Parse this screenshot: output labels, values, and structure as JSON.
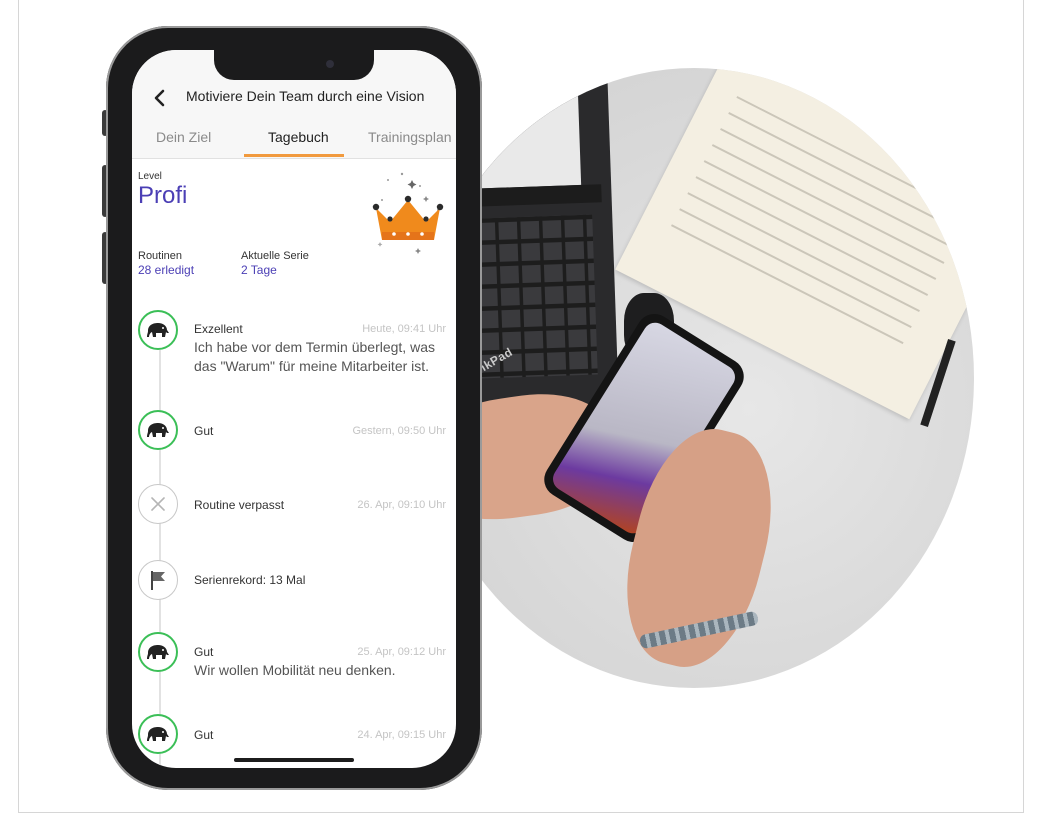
{
  "app": {
    "title": "Motiviere Dein Team durch eine Vision",
    "tabs": [
      {
        "label": "Dein Ziel",
        "active": false
      },
      {
        "label": "Tagebuch",
        "active": true
      },
      {
        "label": "Trainingsplan",
        "active": false
      }
    ]
  },
  "level": {
    "label": "Level",
    "value": "Profi"
  },
  "stats": [
    {
      "label": "Routinen",
      "value": "28 erledigt"
    },
    {
      "label": "Aktuelle Serie",
      "value": "2 Tage"
    }
  ],
  "entries": [
    {
      "icon": "elephant-icon",
      "status": "success",
      "title": "Exzellent",
      "time": "Heute, 09:41 Uhr",
      "text": "Ich habe vor dem Termin überlegt, was das \"Warum\" für meine Mitarbeiter ist."
    },
    {
      "icon": "elephant-icon",
      "status": "success",
      "title": "Gut",
      "time": "Gestern, 09:50 Uhr",
      "text": ""
    },
    {
      "icon": "close-icon",
      "status": "missed",
      "title": "Routine verpasst",
      "time": "26. Apr, 09:10 Uhr",
      "text": ""
    },
    {
      "icon": "flag-icon",
      "status": "record",
      "title": "Serienrekord: 13 Mal",
      "time": "",
      "text": ""
    },
    {
      "icon": "elephant-icon",
      "status": "success",
      "title": "Gut",
      "time": "25. Apr, 09:12 Uhr",
      "text": "Wir wollen Mobilität neu denken."
    },
    {
      "icon": "elephant-icon",
      "status": "success",
      "title": "Gut",
      "time": "24. Apr, 09:15 Uhr",
      "text": ""
    }
  ],
  "photo": {
    "laptop_brand": "ThinkPad"
  },
  "colors": {
    "accent": "#f19a3e",
    "level": "#4b3fb5",
    "success": "#3bbf57"
  }
}
